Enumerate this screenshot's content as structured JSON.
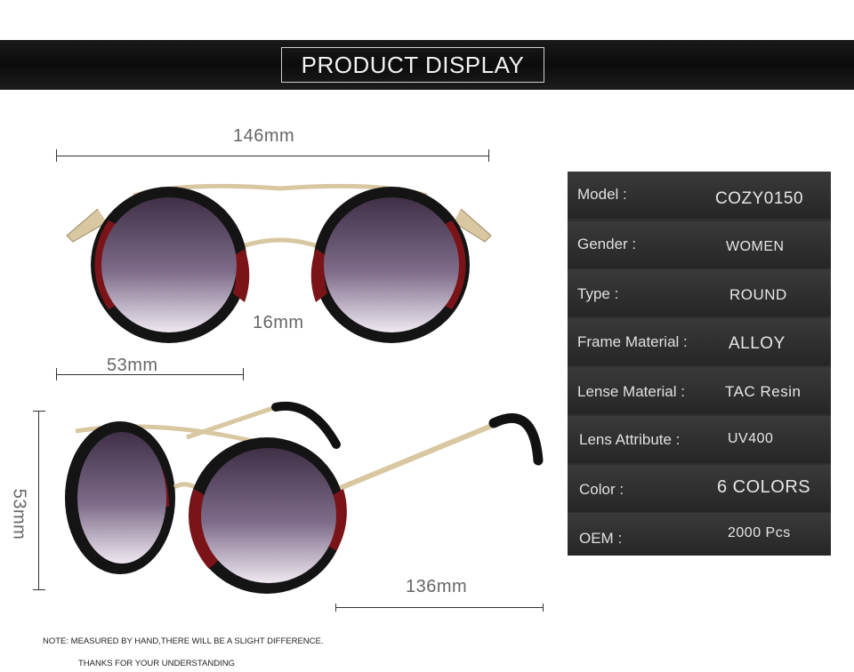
{
  "banner": {
    "title": "PRODUCT DISPLAY"
  },
  "dimensions": {
    "total_width": "146mm",
    "bridge": "16mm",
    "lens_width": "53mm",
    "lens_height": "53mm",
    "temple_length": "136mm"
  },
  "specs": [
    {
      "label": "Model :",
      "value": "COZY0150"
    },
    {
      "label": "Gender :",
      "value": "WOMEN"
    },
    {
      "label": "Type :",
      "value": "ROUND"
    },
    {
      "label": "Frame Material :",
      "value": "ALLOY"
    },
    {
      "label": "Lense Material :",
      "value": "TAC Resin"
    },
    {
      "label": "Lens Attribute :",
      "value": "UV400"
    },
    {
      "label": "Color :",
      "value": "6 COLORS"
    },
    {
      "label": "OEM :",
      "value": "2000 Pcs"
    }
  ],
  "notes": {
    "line1": "NOTE: MEASURED BY HAND,THERE WILL BE A SLIGHT DIFFERENCE.",
    "line2": "THANKS FOR YOUR UNDERSTANDING"
  },
  "colors": {
    "rim_black": "#141414",
    "rim_red": "#7a1418",
    "metal_gold": "#d8c7a0",
    "lens_purple": "#6a5a76"
  }
}
